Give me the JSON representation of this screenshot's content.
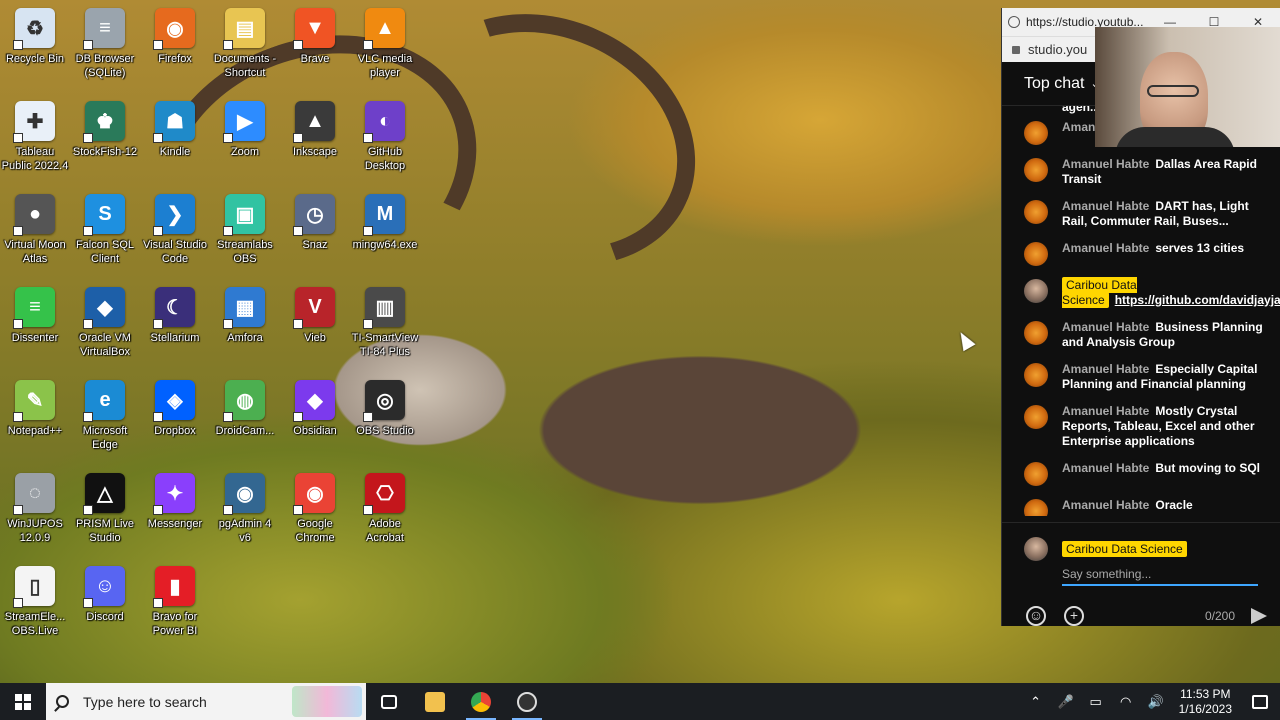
{
  "desktop": {
    "icons": [
      {
        "label": "Recycle Bin",
        "color": "#d7e4f2",
        "glyph": "♻"
      },
      {
        "label": "DB Browser\n(SQLite)",
        "color": "#9aa4ad",
        "glyph": "≡"
      },
      {
        "label": "Firefox",
        "color": "#e66a1e",
        "glyph": "◉"
      },
      {
        "label": "Documents -\nShortcut",
        "color": "#e8c552",
        "glyph": "▤"
      },
      {
        "label": "Brave",
        "color": "#f05424",
        "glyph": "▼"
      },
      {
        "label": "VLC media\nplayer",
        "color": "#f08a10",
        "glyph": "▲"
      },
      {
        "label": "Tableau\nPublic 2022.4",
        "color": "#e9f0f8",
        "glyph": "✚"
      },
      {
        "label": "StockFish-12",
        "color": "#2a7a5a",
        "glyph": "♚"
      },
      {
        "label": "Kindle",
        "color": "#1f8ac9",
        "glyph": "☗"
      },
      {
        "label": "Zoom",
        "color": "#2d8cff",
        "glyph": "▶"
      },
      {
        "label": "Inkscape",
        "color": "#3a3a3a",
        "glyph": "▲"
      },
      {
        "label": "GitHub\nDesktop",
        "color": "#6e40c9",
        "glyph": "◐"
      },
      {
        "label": "Virtual Moon\nAtlas",
        "color": "#555555",
        "glyph": "●"
      },
      {
        "label": "Falcon SQL\nClient",
        "color": "#1e90e0",
        "glyph": "S"
      },
      {
        "label": "Visual Studio\nCode",
        "color": "#1c7fd1",
        "glyph": "❯"
      },
      {
        "label": "Streamlabs\nOBS",
        "color": "#31c3a2",
        "glyph": "▣"
      },
      {
        "label": "Snaz",
        "color": "#5a6a8a",
        "glyph": "◷"
      },
      {
        "label": "mingw64.exe",
        "color": "#2a6fb8",
        "glyph": "M"
      },
      {
        "label": "Dissenter",
        "color": "#35c24a",
        "glyph": "≡"
      },
      {
        "label": "Oracle VM\nVirtualBox",
        "color": "#1d5fa8",
        "glyph": "◆"
      },
      {
        "label": "Stellarium",
        "color": "#3a2f7a",
        "glyph": "☾"
      },
      {
        "label": "Amfora",
        "color": "#2f7ad1",
        "glyph": "▦"
      },
      {
        "label": "Vieb",
        "color": "#b8242a",
        "glyph": "V"
      },
      {
        "label": "TI-SmartView\nTI-84 Plus",
        "color": "#4a4a4a",
        "glyph": "▥"
      },
      {
        "label": "Notepad++",
        "color": "#8bc34a",
        "glyph": "✎"
      },
      {
        "label": "Microsoft\nEdge",
        "color": "#1b8bd4",
        "glyph": "e"
      },
      {
        "label": "Dropbox",
        "color": "#0061ff",
        "glyph": "◈"
      },
      {
        "label": "DroidCam...",
        "color": "#4caf50",
        "glyph": "◍"
      },
      {
        "label": "Obsidian",
        "color": "#7c3aed",
        "glyph": "◆"
      },
      {
        "label": "OBS Studio",
        "color": "#2b2b2b",
        "glyph": "◎"
      },
      {
        "label": "WinJUPOS\n12.0.9",
        "color": "#9aa0a6",
        "glyph": "◌"
      },
      {
        "label": "PRISM Live\nStudio",
        "color": "#111111",
        "glyph": "△"
      },
      {
        "label": "Messenger",
        "color": "#8a3ffc",
        "glyph": "✦"
      },
      {
        "label": "pgAdmin 4\nv6",
        "color": "#336791",
        "glyph": "◉"
      },
      {
        "label": "Google\nChrome",
        "color": "#ea4335",
        "glyph": "◉"
      },
      {
        "label": "Adobe\nAcrobat",
        "color": "#c4161c",
        "glyph": "⎔"
      },
      {
        "label": "StreamEle...\nOBS.Live",
        "color": "#f4f4f4",
        "glyph": "▯"
      },
      {
        "label": "Discord",
        "color": "#5865f2",
        "glyph": "☺"
      },
      {
        "label": "Bravo for\nPower BI",
        "color": "#e41e26",
        "glyph": "▮"
      }
    ]
  },
  "chat_window": {
    "url_title": "https://studio.youtub...",
    "address": "studio.you",
    "min": "—",
    "max": "☐",
    "close": "✕",
    "header": "Top chat",
    "header_chevron": "⌄",
    "clipped_message": "agen...",
    "messages": [
      {
        "author": "Amanuel Habte",
        "text": "years",
        "owner": false
      },
      {
        "author": "Amanuel Habte",
        "text": "Dallas Area Rapid Transit",
        "owner": false
      },
      {
        "author": "Amanuel Habte",
        "text": "DART has, Light Rail, Commuter Rail, Buses...",
        "owner": false
      },
      {
        "author": "Amanuel Habte",
        "text": "serves 13 cities",
        "owner": false
      },
      {
        "author": "Caribou Data Science",
        "text": "https://github.com/davidjayjackson/Wo...",
        "owner": true
      },
      {
        "author": "Amanuel Habte",
        "text": "Business Planning and Analysis Group",
        "owner": false
      },
      {
        "author": "Amanuel Habte",
        "text": "Especially Capital Planning and Financial planning",
        "owner": false
      },
      {
        "author": "Amanuel Habte",
        "text": "Mostly Crystal Reports, Tableau, Excel and other Enterprise applications",
        "owner": false
      },
      {
        "author": "Amanuel Habte",
        "text": "But moving to SQl",
        "owner": false
      },
      {
        "author": "Amanuel Habte",
        "text": "Oracle",
        "owner": false
      }
    ],
    "composer": {
      "author": "Caribou Data Science",
      "placeholder": "Say something...",
      "counter": "0/200",
      "emoji_icon": "☺",
      "add_icon": "+"
    }
  },
  "taskbar": {
    "search_placeholder": "Type here to search",
    "time": "11:53 PM",
    "date": "1/16/2023",
    "tray_chevron": "⌃",
    "tray_mic": "🎤",
    "tray_battery": "▭",
    "tray_wifi": "◠",
    "tray_volume": "🔊"
  }
}
